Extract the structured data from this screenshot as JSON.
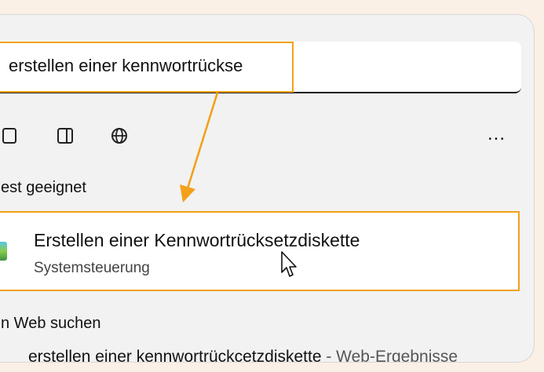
{
  "search": {
    "query": "erstellen einer kennwortrückse"
  },
  "filters": {
    "icons": [
      "document-icon",
      "app-window-icon",
      "globe-icon"
    ],
    "more_label": "..."
  },
  "best_match": {
    "heading": "est geeignet",
    "title": "Erstellen einer Kennwortrücksetzdiskette",
    "subtitle": "Systemsteuerung",
    "icon": "control-panel-icon"
  },
  "web": {
    "heading": "n Web suchen",
    "suggestion": "erstellen einer kennwortrückcetzdiskette",
    "suffix": " - Web-Ergebnisse"
  },
  "colors": {
    "highlight": "#f3a11b",
    "panel": "#f2f2f2",
    "background": "#fbf0e6"
  }
}
